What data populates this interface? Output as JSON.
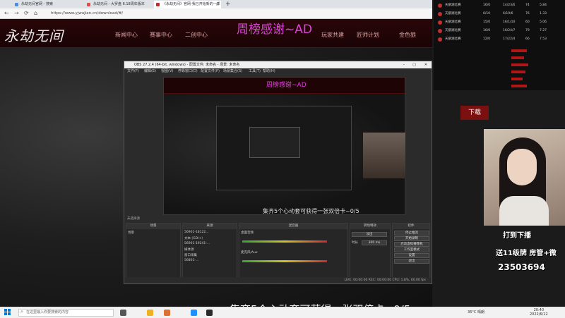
{
  "browser": {
    "tabs": [
      {
        "label": "永劫无间官网 - 搜索",
        "color": "#4b8de0"
      },
      {
        "label": "永劫无间 - 大罗盘 6.18周年版本",
        "color": "#e04b4b"
      },
      {
        "label": "《永劫无间》官网-我已开始新的一季",
        "color": "#c42a2a"
      }
    ],
    "url": "https://www.yjwujian.cn/download/#/"
  },
  "site": {
    "logo": "永劫无间",
    "nav": [
      "新闻中心",
      "赛事中心",
      "二创中心",
      "",
      "",
      "玩家共建",
      "匠师计划",
      "金色狼"
    ],
    "banner": "周榜感谢~AD",
    "red_button": "下载"
  },
  "stats": {
    "rows": [
      {
        "name": "天鹅湖比赛",
        "a": "16/0",
        "b": "14/23/6",
        "c": "74",
        "d": "5.84"
      },
      {
        "name": "天鹅湖比赛",
        "a": "6/10",
        "b": "6/19/6",
        "c": "76",
        "d": "1.33"
      },
      {
        "name": "天鹅湖比赛",
        "a": "15/0",
        "b": "16/1/10",
        "c": "60",
        "d": "5.06"
      },
      {
        "name": "天鹅湖比赛",
        "a": "16/0",
        "b": "16/24/7",
        "c": "79",
        "d": "7.27"
      },
      {
        "name": "天鹅湖比赛",
        "a": "12/0",
        "b": "17/22/4",
        "c": "66",
        "d": "7.53"
      }
    ]
  },
  "obs": {
    "title": "OBS 27.2.4 (64-bit, windows) - 配置文件: 未命名 - 场景: 未命名",
    "menu": [
      "文件(F)",
      "编辑(E)",
      "视图(V)",
      "停靠窗口(D)",
      "配置文件(P)",
      "场景集合(S)",
      "工具(T)",
      "帮助(H)"
    ],
    "preview_banner": "周榜感谢~AD",
    "preview_caption": "集齐5个心动套可获得一张双倍卡~0/5",
    "source_toolbar": "未选择源",
    "docks": {
      "scenes": {
        "title": "场景",
        "items": [
          "场景"
        ]
      },
      "sources": {
        "title": "来源",
        "items": [
          "56901-18122...",
          "文本 (GDI+)",
          "56901-19241-...",
          "媒体源",
          "窗口采集",
          "56801-..."
        ]
      },
      "mixer": {
        "title": "混音器",
        "items": [
          "桌面音频",
          "麦克风/Aux"
        ]
      },
      "transitions": {
        "title": "转场特效",
        "fade": "淡出",
        "duration_label": "时长",
        "duration": "300 ms"
      },
      "controls": {
        "title": "控件",
        "buttons": [
          "停止推流",
          "开始录制",
          "启动虚拟摄像机",
          "工作室模式",
          "设置",
          "退出"
        ]
      }
    },
    "status": "LIVE: 00:00:00   REC: 00:00:00   CPU: 1.8%, 60.00 fps"
  },
  "webcam": {
    "overlay1": "打到下播",
    "overlay2": "送11级牌 房管+微",
    "overlay3": "23503694"
  },
  "caption": "集齐5个心动套可获得一张双倍卡~0/5",
  "taskbar": {
    "search_placeholder": "在这里输入你要搜索的内容",
    "weather": "36°C 晴朗",
    "time": "20:40",
    "date": "2022/6/12"
  }
}
